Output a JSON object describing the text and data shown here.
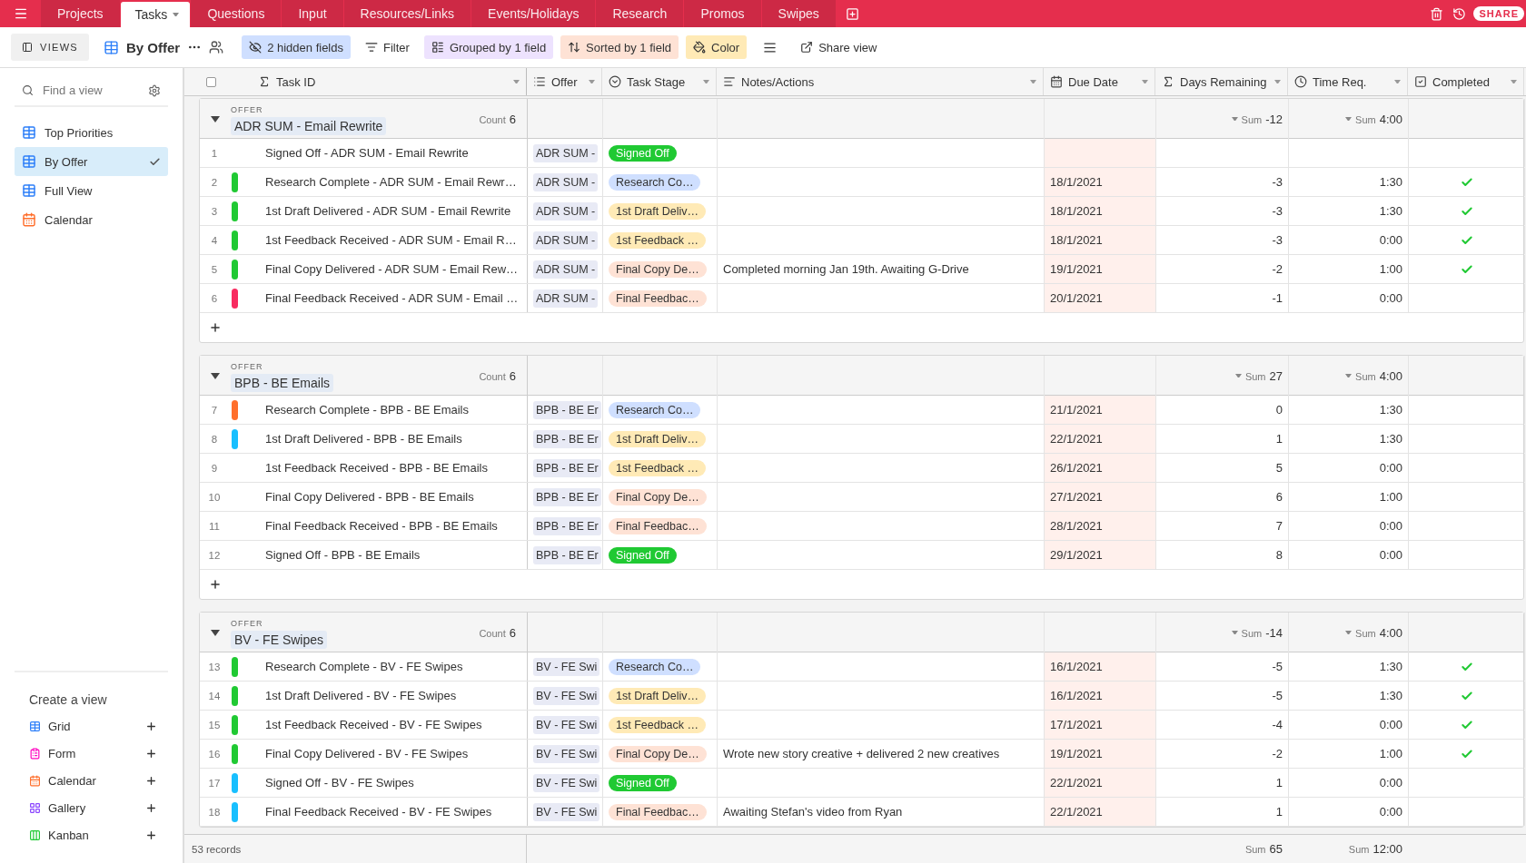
{
  "tabs": [
    {
      "label": "Projects",
      "selected": false
    },
    {
      "label": "Tasks",
      "selected": true
    },
    {
      "label": "Questions",
      "selected": false
    },
    {
      "label": "Input",
      "selected": false
    },
    {
      "label": "Resources/Links",
      "selected": false
    },
    {
      "label": "Events/Holidays",
      "selected": false
    },
    {
      "label": "Research",
      "selected": false
    },
    {
      "label": "Promos",
      "selected": false
    },
    {
      "label": "Swipes",
      "selected": false
    }
  ],
  "share": "SHARE",
  "toolbar": {
    "views": "VIEWS",
    "view_name": "By Offer",
    "hidden_fields": "2 hidden fields",
    "filter": "Filter",
    "grouped": "Grouped by 1 field",
    "sorted": "Sorted by 1 field",
    "color_button": "Color",
    "share_view": "Share view"
  },
  "select_all": {
    "checked": false
  },
  "sidebar": {
    "search": {
      "placeholder": "Find a view"
    },
    "views": [
      {
        "label": "Top Priorities",
        "kind": "grid",
        "selected": false
      },
      {
        "label": "By Offer",
        "kind": "grid",
        "selected": true
      },
      {
        "label": "Full View",
        "kind": "grid",
        "selected": false
      },
      {
        "label": "Calendar",
        "kind": "calendar",
        "selected": false
      }
    ],
    "create_title": "Create a view",
    "create_items": [
      {
        "label": "Grid",
        "kind": "grid"
      },
      {
        "label": "Form",
        "kind": "form"
      },
      {
        "label": "Calendar",
        "kind": "calendar"
      },
      {
        "label": "Gallery",
        "kind": "gallery"
      },
      {
        "label": "Kanban",
        "kind": "kanban"
      }
    ]
  },
  "columns": [
    {
      "label": "Task ID",
      "kind": "formula"
    },
    {
      "label": "Offer",
      "kind": "link"
    },
    {
      "label": "Task Stage",
      "kind": "select"
    },
    {
      "label": "Notes/Actions",
      "kind": "longtext"
    },
    {
      "label": "Due Date",
      "kind": "date"
    },
    {
      "label": "Days Remaining",
      "kind": "formula"
    },
    {
      "label": "Time Req.",
      "kind": "duration"
    },
    {
      "label": "Completed",
      "kind": "checkbox"
    }
  ],
  "groups": [
    {
      "field": "OFFER",
      "add_row": true,
      "name": "ADR SUM - Email Rewrite",
      "count": {
        "label": "Count",
        "value": "6"
      },
      "days_sum": {
        "label": "Sum",
        "value": "-12"
      },
      "time_sum": {
        "label": "Sum",
        "value": "4:00"
      },
      "rows": [
        {
          "number": "1",
          "task": "Signed Off - ADR SUM - Email Rewrite",
          "offer": "ADR SUM -",
          "stage": {
            "label": "Signed Off",
            "color": "#20c933"
          },
          "completed": false
        },
        {
          "number": "2",
          "color": "#20c933",
          "task": "Research Complete - ADR SUM - Email Rewr…",
          "offer": "ADR SUM -",
          "stage": {
            "label": "Research Co…",
            "color": "#cfdfff"
          },
          "due": "18/1/2021",
          "days": "-3",
          "time": "1:30",
          "completed": true
        },
        {
          "number": "3",
          "color": "#20c933",
          "task": "1st Draft Delivered - ADR SUM - Email Rewrite",
          "offer": "ADR SUM -",
          "stage": {
            "label": "1st Draft Deliv…",
            "color": "#ffeab6"
          },
          "due": "18/1/2021",
          "days": "-3",
          "time": "1:30",
          "completed": true
        },
        {
          "number": "4",
          "color": "#20c933",
          "task": "1st Feedback Received - ADR SUM - Email R…",
          "offer": "ADR SUM -",
          "stage": {
            "label": "1st Feedback …",
            "color": "#ffeab6"
          },
          "due": "18/1/2021",
          "days": "-3",
          "time": "0:00",
          "completed": true
        },
        {
          "number": "5",
          "color": "#20c933",
          "task": "Final Copy Delivered - ADR SUM - Email Rew…",
          "offer": "ADR SUM -",
          "stage": {
            "label": "Final Copy De…",
            "color": "#fee2d5"
          },
          "notes": "Completed morning Jan 19th. Awaiting G-Drive",
          "due": "19/1/2021",
          "days": "-2",
          "time": "1:00",
          "completed": true
        },
        {
          "number": "6",
          "color": "#f82b60",
          "task": "Final Feedback Received - ADR SUM - Email …",
          "offer": "ADR SUM -",
          "stage": {
            "label": "Final Feedbac…",
            "color": "#fee2d5"
          },
          "due": "20/1/2021",
          "days": "-1",
          "time": "0:00",
          "completed": false
        }
      ]
    },
    {
      "field": "OFFER",
      "add_row": true,
      "name": "BPB - BE Emails",
      "count": {
        "label": "Count",
        "value": "6"
      },
      "days_sum": {
        "label": "Sum",
        "value": "27"
      },
      "time_sum": {
        "label": "Sum",
        "value": "4:00"
      },
      "rows": [
        {
          "number": "7",
          "color": "#ff6f2c",
          "task": "Research Complete - BPB - BE Emails",
          "offer": "BPB - BE Er",
          "stage": {
            "label": "Research Co…",
            "color": "#cfdfff"
          },
          "due": "21/1/2021",
          "days": "0",
          "time": "1:30",
          "completed": false
        },
        {
          "number": "8",
          "color": "#18bfff",
          "task": "1st Draft Delivered - BPB - BE Emails",
          "offer": "BPB - BE Er",
          "stage": {
            "label": "1st Draft Deliv…",
            "color": "#ffeab6"
          },
          "due": "22/1/2021",
          "days": "1",
          "time": "1:30",
          "completed": false
        },
        {
          "number": "9",
          "task": "1st Feedback Received - BPB - BE Emails",
          "offer": "BPB - BE Er",
          "stage": {
            "label": "1st Feedback …",
            "color": "#ffeab6"
          },
          "due": "26/1/2021",
          "days": "5",
          "time": "0:00",
          "completed": false
        },
        {
          "number": "10",
          "task": "Final Copy Delivered - BPB - BE Emails",
          "offer": "BPB - BE Er",
          "stage": {
            "label": "Final Copy De…",
            "color": "#fee2d5"
          },
          "due": "27/1/2021",
          "days": "6",
          "time": "1:00",
          "completed": false
        },
        {
          "number": "11",
          "task": "Final Feedback Received - BPB - BE Emails",
          "offer": "BPB - BE Er",
          "stage": {
            "label": "Final Feedbac…",
            "color": "#fee2d5"
          },
          "due": "28/1/2021",
          "days": "7",
          "time": "0:00",
          "completed": false
        },
        {
          "number": "12",
          "task": "Signed Off - BPB - BE Emails",
          "offer": "BPB - BE Er",
          "stage": {
            "label": "Signed Off",
            "color": "#20c933"
          },
          "due": "29/1/2021",
          "days": "8",
          "time": "0:00",
          "completed": false
        }
      ]
    },
    {
      "field": "OFFER",
      "name": "BV - FE Swipes",
      "count": {
        "label": "Count",
        "value": "6"
      },
      "days_sum": {
        "label": "Sum",
        "value": "-14"
      },
      "time_sum": {
        "label": "Sum",
        "value": "4:00"
      },
      "rows": [
        {
          "number": "13",
          "color": "#20c933",
          "task": "Research Complete - BV - FE Swipes",
          "offer": "BV - FE Swi",
          "stage": {
            "label": "Research Co…",
            "color": "#cfdfff"
          },
          "due": "16/1/2021",
          "days": "-5",
          "time": "1:30",
          "completed": true
        },
        {
          "number": "14",
          "color": "#20c933",
          "task": "1st Draft Delivered - BV - FE Swipes",
          "offer": "BV - FE Swi",
          "stage": {
            "label": "1st Draft Deliv…",
            "color": "#ffeab6"
          },
          "due": "16/1/2021",
          "days": "-5",
          "time": "1:30",
          "completed": true
        },
        {
          "number": "15",
          "color": "#20c933",
          "task": "1st Feedback Received - BV - FE Swipes",
          "offer": "BV - FE Swi",
          "stage": {
            "label": "1st Feedback …",
            "color": "#ffeab6"
          },
          "due": "17/1/2021",
          "days": "-4",
          "time": "0:00",
          "completed": true
        },
        {
          "number": "16",
          "color": "#20c933",
          "task": "Final Copy Delivered - BV - FE Swipes",
          "offer": "BV - FE Swi",
          "stage": {
            "label": "Final Copy De…",
            "color": "#fee2d5"
          },
          "notes": "Wrote new story creative + delivered 2 new creatives",
          "due": "19/1/2021",
          "days": "-2",
          "time": "1:00",
          "completed": true
        },
        {
          "number": "17",
          "color": "#18bfff",
          "task": "Signed Off - BV - FE Swipes",
          "offer": "BV - FE Swi",
          "stage": {
            "label": "Signed Off",
            "color": "#20c933"
          },
          "due": "22/1/2021",
          "days": "1",
          "time": "0:00",
          "completed": false
        },
        {
          "number": "18",
          "color": "#18bfff",
          "task": "Final Feedback Received - BV - FE Swipes",
          "offer": "BV - FE Swi",
          "stage": {
            "label": "Final Feedbac…",
            "color": "#fee2d5"
          },
          "notes": "Awaiting Stefan's video from Ryan",
          "due": "22/1/2021",
          "days": "1",
          "time": "0:00",
          "completed": false
        }
      ]
    }
  ],
  "footer": {
    "records": "53 records",
    "days_sum": {
      "label": "Sum",
      "value": "65"
    },
    "time_sum": {
      "label": "Sum",
      "value": "12:00"
    }
  }
}
